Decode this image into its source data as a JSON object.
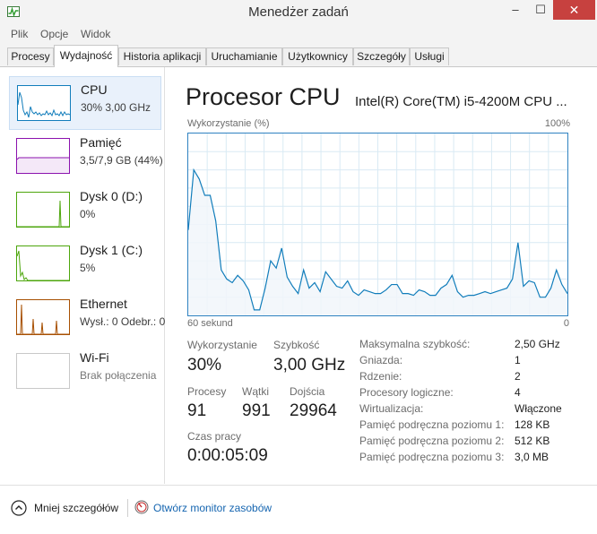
{
  "window": {
    "title": "Menedżer zadań",
    "minimize": "–",
    "maximize": "☐",
    "close": "✕",
    "app_icon": "task-manager-icon"
  },
  "menu": [
    "Plik",
    "Opcje",
    "Widok"
  ],
  "tabs": [
    "Procesy",
    "Wydajność",
    "Historia aplikacji",
    "Uruchamianie",
    "Użytkownicy",
    "Szczegóły",
    "Usługi"
  ],
  "active_tab": "Wydajność",
  "resources": [
    {
      "name": "CPU",
      "detail": "30% 3,00 GHz",
      "color": "#117dbb",
      "selected": true
    },
    {
      "name": "Pamięć",
      "detail": "3,5/7,9 GB (44%)",
      "color": "#8b12ae"
    },
    {
      "name": "Dysk 0 (D:)",
      "detail": "0%",
      "color": "#4da60c"
    },
    {
      "name": "Dysk 1 (C:)",
      "detail": "5%",
      "color": "#4da60c"
    },
    {
      "name": "Ethernet",
      "detail": "Wysł.: 0  Odebr.: 0",
      "color": "#a74f01"
    },
    {
      "name": "Wi-Fi",
      "detail": "Brak połączenia",
      "color": "#a0a0a0"
    }
  ],
  "main": {
    "title": "Procesor CPU",
    "model": "Intel(R) Core(TM) i5-4200M CPU ...",
    "graph": {
      "y_label": "Wykorzystanie (%)",
      "y_max_label": "100%",
      "x_left_label": "60 sekund",
      "x_right_label": "0",
      "line_color": "#117dbb",
      "fill_color": "#f1f6fa",
      "grid_color": "#d9eaf4",
      "values": [
        47,
        80,
        75,
        66,
        66,
        52,
        25,
        20,
        18,
        22,
        19,
        14,
        3,
        3,
        15,
        30,
        26,
        37,
        21,
        16,
        12,
        25,
        15,
        18,
        13,
        24,
        20,
        16,
        15,
        19,
        13,
        11,
        14,
        13,
        12,
        12,
        14,
        17,
        17,
        12,
        12,
        11,
        14,
        13,
        11,
        11,
        15,
        17,
        22,
        13,
        10,
        11,
        11,
        12,
        13,
        12,
        13,
        14,
        15,
        20,
        40,
        16,
        19,
        18,
        10,
        10,
        15,
        25,
        17,
        12
      ]
    },
    "stats": {
      "usage": {
        "label": "Wykorzystanie",
        "value": "30%"
      },
      "speed": {
        "label": "Szybkość",
        "value": "3,00 GHz"
      },
      "processes": {
        "label": "Procesy",
        "value": "91"
      },
      "threads": {
        "label": "Wątki",
        "value": "991"
      },
      "handles": {
        "label": "Dojścia",
        "value": "29964"
      },
      "uptime": {
        "label": "Czas pracy",
        "value": "0:00:05:09"
      }
    },
    "details": [
      {
        "label": "Maksymalna szybkość:",
        "value": "2,50 GHz"
      },
      {
        "label": "Gniazda:",
        "value": "1"
      },
      {
        "label": "Rdzenie:",
        "value": "2"
      },
      {
        "label": "Procesory logiczne:",
        "value": "4"
      },
      {
        "label": "Wirtualizacja:",
        "value": "Włączone"
      },
      {
        "label": "Pamięć podręczna poziomu 1:",
        "value": "128 KB"
      },
      {
        "label": "Pamięć podręczna poziomu 2:",
        "value": "512 KB"
      },
      {
        "label": "Pamięć podręczna poziomu 3:",
        "value": "3,0 MB"
      }
    ]
  },
  "footer": {
    "less_details": "Mniej szczegółów",
    "less_icon": "chevron-up-circle-icon",
    "open_monitor": "Otwórz monitor zasobów",
    "monitor_icon": "resource-monitor-icon"
  }
}
